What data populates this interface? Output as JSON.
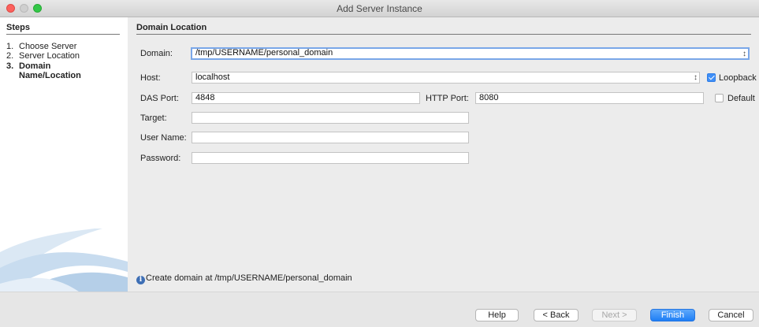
{
  "window": {
    "title": "Add Server Instance"
  },
  "steps": {
    "heading": "Steps",
    "items": [
      {
        "num": "1.",
        "label": "Choose Server"
      },
      {
        "num": "2.",
        "label": "Server Location"
      },
      {
        "num": "3.",
        "label": "Domain",
        "label2": "Name/Location"
      }
    ],
    "active_index": 2
  },
  "main": {
    "section_title": "Domain Location",
    "domain": {
      "label": "Domain:",
      "value": "/tmp/USERNAME/personal_domain"
    },
    "host": {
      "label": "Host:",
      "value": "localhost",
      "loopback_label": "Loopback",
      "loopback_checked": true
    },
    "das_port": {
      "label": "DAS Port:",
      "value": "4848"
    },
    "http_port": {
      "label": "HTTP Port:",
      "value": "8080",
      "default_label": "Default",
      "default_checked": false
    },
    "target": {
      "label": "Target:",
      "value": ""
    },
    "user_name": {
      "label": "User Name:",
      "value": ""
    },
    "password": {
      "label": "Password:",
      "value": ""
    },
    "info_message": "Create domain at /tmp/USERNAME/personal_domain"
  },
  "buttons": {
    "help": "Help",
    "back": "< Back",
    "next": "Next >",
    "finish": "Finish",
    "cancel": "Cancel"
  },
  "icons": {
    "combo_arrow": "up-down-chevron-icon",
    "info": "info-icon",
    "steps_decoration": "wave-graphic"
  },
  "colors": {
    "accent": "#3f8ff7",
    "primary_button": "#1e7ef5",
    "info_icon": "#3e6fb5",
    "close": "#fc615d",
    "maximize": "#33c748"
  }
}
